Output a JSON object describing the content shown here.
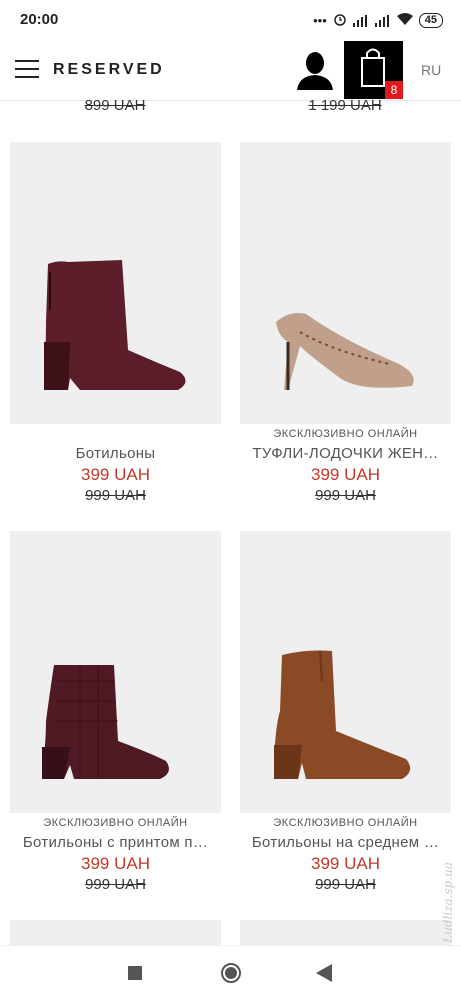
{
  "status_bar": {
    "time": "20:00",
    "battery": "45"
  },
  "header": {
    "brand": "RESERVED",
    "cart_count": "8",
    "language": "RU"
  },
  "previous_row_prices": [
    "899 UAH",
    "1 199 UAH"
  ],
  "products": [
    {
      "badge": "",
      "name": "Ботильоны",
      "price": "399 UAH",
      "old_price": "999 UAH"
    },
    {
      "badge": "ЭКСКЛЮЗИВНО ОНЛАЙН",
      "name": "ТУФЛИ-ЛОДОЧКИ ЖЕН…",
      "price": "399 UAH",
      "old_price": "999 UAH"
    },
    {
      "badge": "ЭКСКЛЮЗИВНО ОНЛАЙН",
      "name": "Ботильоны с принтом п…",
      "price": "399 UAH",
      "old_price": "999 UAH"
    },
    {
      "badge": "ЭКСКЛЮЗИВНО ОНЛАЙН",
      "name": "Ботильоны на среднем …",
      "price": "399 UAH",
      "old_price": "999 UAH"
    }
  ],
  "watermark": "Ludliza.sp.ua",
  "colors": {
    "price": "#c0392b",
    "cart_badge": "#e0191e",
    "image_bg": "#efefef"
  }
}
